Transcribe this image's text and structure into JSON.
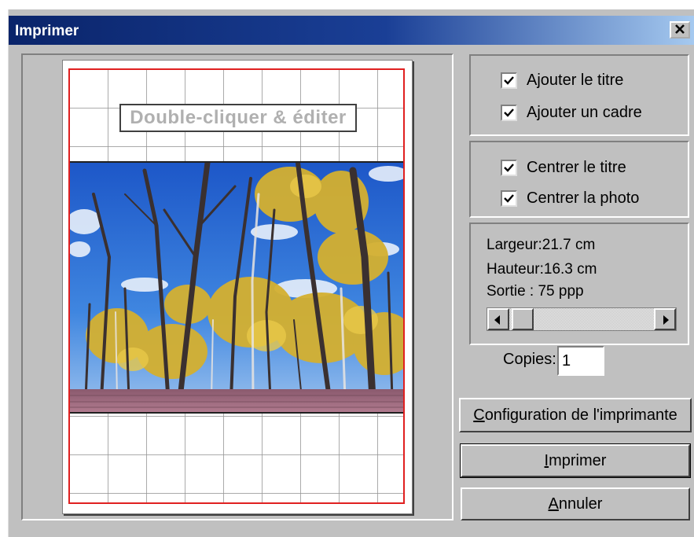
{
  "window": {
    "title": "Imprimer",
    "close_label": "✕"
  },
  "preview": {
    "title_placeholder": "Double-cliquer & éditer"
  },
  "options_group1": [
    {
      "label": "Ajouter le titre",
      "checked": true
    },
    {
      "label": "Ajouter un cadre",
      "checked": true
    }
  ],
  "options_group2": [
    {
      "label": "Centrer le titre",
      "checked": true
    },
    {
      "label": "Centrer la photo",
      "checked": true
    }
  ],
  "info": {
    "width": "Largeur:21.7 cm",
    "height": "Hauteur:16.3 cm",
    "output": "Sortie : 75 ppp",
    "resolution_fraction": 0.02
  },
  "copies": {
    "label": "Copies:",
    "value": "1"
  },
  "buttons": {
    "printer_setup": {
      "mnemonic": "C",
      "rest": "onfiguration de l'imprimante"
    },
    "print": {
      "mnemonic": "I",
      "rest": "mprimer"
    },
    "cancel": {
      "mnemonic": "A",
      "rest": "nnuler"
    }
  },
  "colors": {
    "titlebar_start": "#0a246a",
    "margin_border": "#e02020",
    "dialog_bg": "#c0c0c0"
  }
}
